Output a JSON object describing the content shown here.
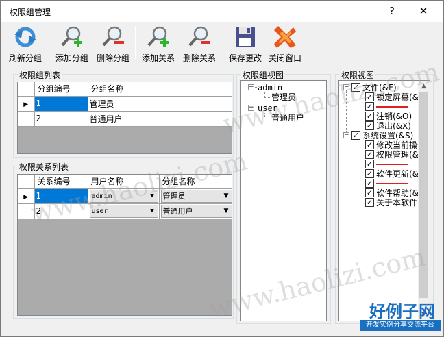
{
  "window": {
    "title": "权限组管理",
    "help_glyph": "?",
    "close_glyph": "✕"
  },
  "toolbar": {
    "refresh_group": "刷新分组",
    "add_group": "添加分组",
    "delete_group": "删除分组",
    "add_relation": "添加关系",
    "delete_relation": "删除关系",
    "save_changes": "保存更改",
    "close_window": "关闭窗口"
  },
  "group_list": {
    "label": "权限组列表",
    "columns": [
      "分组编号",
      "分组名称"
    ],
    "rows": [
      {
        "id": "1",
        "name": "管理员"
      },
      {
        "id": "2",
        "name": "普通用户"
      }
    ]
  },
  "relation_list": {
    "label": "权限关系列表",
    "columns": [
      "关系编号",
      "用户名称",
      "分组名称"
    ],
    "rows": [
      {
        "id": "1",
        "user": "admin",
        "group": "管理员"
      },
      {
        "id": "2",
        "user": "user",
        "group": "普通用户"
      }
    ]
  },
  "group_view": {
    "label": "权限组视图",
    "nodes": [
      {
        "text": "admin",
        "children": [
          "管理员"
        ]
      },
      {
        "text": "user",
        "children": [
          "普通用户"
        ]
      }
    ]
  },
  "permission_view": {
    "label": "权限视图",
    "file": "文件(&F)",
    "file_items": [
      "锁定屏幕(&L)",
      "注销(&O)",
      "退出(&X)"
    ],
    "settings": "系统设置(&S)",
    "settings_items": [
      "修改当前操作员",
      "权限管理(&R)",
      "软件更新(&U)",
      "软件帮助(&H)",
      "关于本软件(&A)"
    ]
  },
  "watermark": "www.haolizi.com",
  "brand": {
    "title": "好例子网",
    "subtitle": "开发实例分享交流平台"
  },
  "colors": {
    "selection": "#0078d7",
    "separator_red": "#e02020"
  }
}
